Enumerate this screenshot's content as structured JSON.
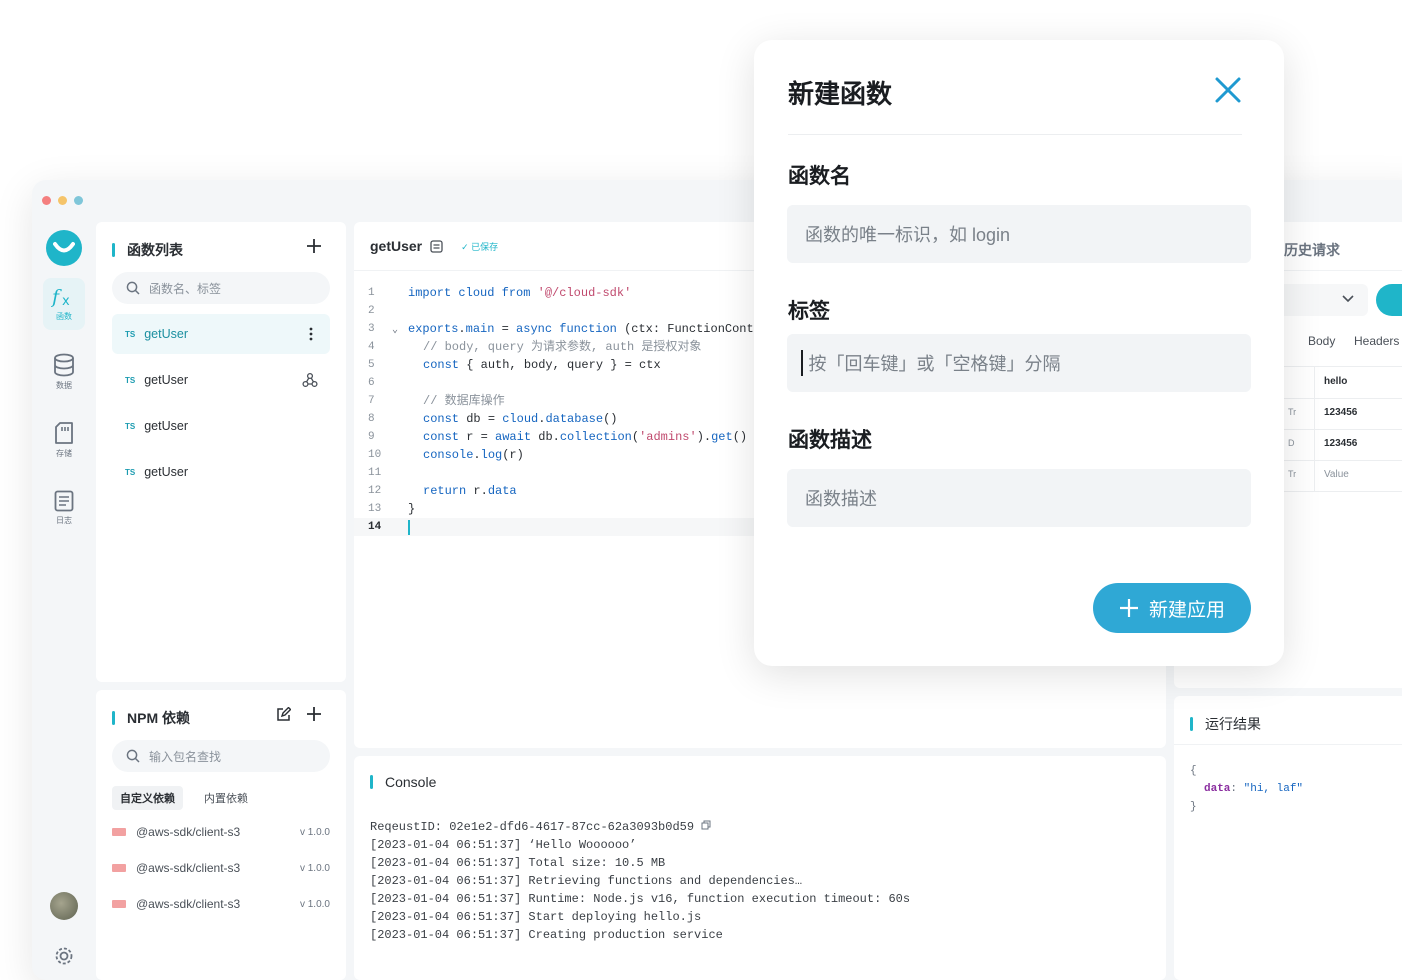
{
  "functions_panel": {
    "title": "函数列表",
    "search_placeholder": "函数名、标签",
    "items": [
      {
        "lang": "TS",
        "name": "getUser"
      },
      {
        "lang": "TS",
        "name": "getUser"
      },
      {
        "lang": "TS",
        "name": "getUser"
      },
      {
        "lang": "TS",
        "name": "getUser"
      }
    ]
  },
  "rail": {
    "items": [
      "函数",
      "数据",
      "存储",
      "日志"
    ]
  },
  "npm_panel": {
    "title": "NPM 依赖",
    "search_placeholder": "输入包名查找",
    "tabs": [
      "自定义依赖",
      "内置依赖"
    ],
    "deps": [
      {
        "name": "@aws-sdk/client-s3",
        "version": "v 1.0.0"
      },
      {
        "name": "@aws-sdk/client-s3",
        "version": "v 1.0.0"
      },
      {
        "name": "@aws-sdk/client-s3",
        "version": "v 1.0.0"
      }
    ]
  },
  "editor": {
    "filename": "getUser",
    "saved_label": "✓ 已保存",
    "line_numbers": [
      "1",
      "2",
      "3",
      "4",
      "5",
      "6",
      "7",
      "8",
      "9",
      "10",
      "11",
      "12",
      "13",
      "14"
    ]
  },
  "console": {
    "title": "Console",
    "lines": [
      "ReqeustID: 02e1e2-dfd6-4617-87cc-62a3093b0d59",
      "[2023-01-04 06:51:37] ‘Hello Woooooo’",
      "[2023-01-04 06:51:37] Total size: 10.5 MB",
      "[2023-01-04 06:51:37] Retrieving functions and dependencies…",
      "[2023-01-04 06:51:37] Runtime: Node.js v16, function execution timeout: 60s",
      "[2023-01-04 06:51:37] Start deploying hello.js",
      "[2023-01-04 06:51:37] Creating production service"
    ]
  },
  "right_panel": {
    "history_label": "历史请求",
    "tabs": [
      "Body",
      "Headers"
    ],
    "rows": [
      {
        "type": "",
        "value": "hello"
      },
      {
        "type": "Tr",
        "value": "123456"
      },
      {
        "type": "D",
        "value": "123456"
      },
      {
        "type": "Tr",
        "value": "Value"
      }
    ]
  },
  "result_panel": {
    "title": "运行结果",
    "open": "{",
    "key": "data",
    "colon": ":",
    "value": "\"hi, laf\"",
    "close": "}"
  },
  "modal": {
    "title": "新建函数",
    "name_label": "函数名",
    "name_placeholder": "函数的唯一标识，如 login",
    "tags_label": "标签",
    "tags_placeholder": "按「回车键」或「空格键」分隔",
    "desc_label": "函数描述",
    "desc_placeholder": "函数描述",
    "submit_label": "新建应用"
  },
  "colors": {
    "accent": "#1fb5c9",
    "button": "#2fa8d5",
    "dot_red": "#f47f7f",
    "dot_yellow": "#f5c46a",
    "dot_green": "#7fc6d9"
  }
}
